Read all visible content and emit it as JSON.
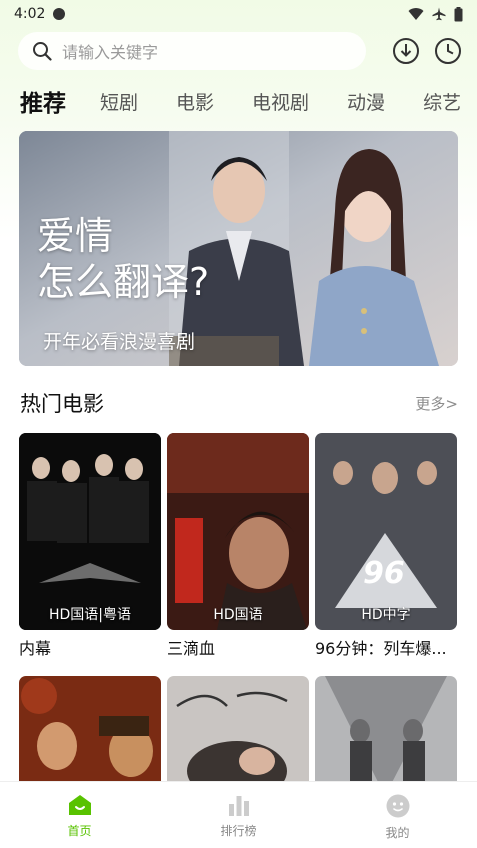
{
  "status_bar": {
    "time": "4:02"
  },
  "search": {
    "placeholder": "请输入关键字"
  },
  "tabs": [
    {
      "label": "推荐",
      "active": true
    },
    {
      "label": "短剧"
    },
    {
      "label": "电影"
    },
    {
      "label": "电视剧"
    },
    {
      "label": "动漫"
    },
    {
      "label": "综艺"
    }
  ],
  "banner": {
    "title_line1": "爱情",
    "title_line2": "怎么翻译?",
    "subtitle": "开年必看浪漫喜剧"
  },
  "section": {
    "title": "热门电影",
    "more": "更多>"
  },
  "movies": [
    {
      "title": "内幕",
      "badge": "HD国语|粤语"
    },
    {
      "title": "三滴血",
      "badge": "HD国语"
    },
    {
      "title": "96分钟：列车爆...",
      "badge": "HD中字"
    },
    {
      "title": "",
      "badge": ""
    },
    {
      "title": "",
      "badge": ""
    },
    {
      "title": "",
      "badge": ""
    }
  ],
  "bottom_nav": [
    {
      "label": "首页",
      "icon": "home-icon",
      "active": true
    },
    {
      "label": "排行榜",
      "icon": "ranking-icon"
    },
    {
      "label": "我的",
      "icon": "profile-icon"
    }
  ],
  "colors": {
    "accent": "#58c200",
    "header_bg": "#f1fbe6"
  }
}
